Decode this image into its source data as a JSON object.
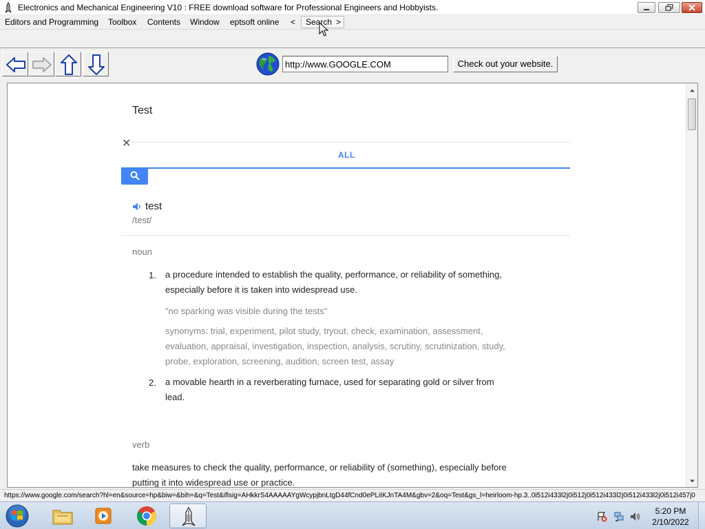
{
  "window": {
    "title": "Electronics and Mechanical Engineering V10 : FREE download software for Professional Engineers and Hobbyists."
  },
  "menu": {
    "items": [
      "Editors and Programming",
      "Toolbox",
      "Contents",
      "Window",
      "eptsoft online",
      "<"
    ],
    "search_label": "Search",
    "search_arrow": ">"
  },
  "navbar": {
    "url_value": "http://www.GOOGLE.COM",
    "check_button": "Check out your website."
  },
  "page": {
    "query": "Test",
    "close_symbol": "✕",
    "tab_all": "ALL",
    "word": "test",
    "phonetic": "/test/",
    "noun_label": "noun",
    "definitions": [
      {
        "number": "1.",
        "line1": "a procedure intended to establish the quality, performance, or reliability of something,",
        "line2": "especially before it is taken into widespread use."
      },
      {
        "number": "2.",
        "line1": "a movable hearth in a reverberating furnace, used for separating gold or silver from",
        "line2": "lead."
      }
    ],
    "example": "\"no sparking was visible during the tests\"",
    "synonyms_lines": [
      "synonyms: trial, experiment, pilot study, tryout, check, examination, assessment,",
      "evaluation, appraisal, investigation, inspection, analysis, scrutiny, scrutinization, study,",
      "probe, exploration, screening, audition, screen test, assay"
    ],
    "verb_label": "verb",
    "verb_line1": "take measures to check the quality, performance, or reliability of (something), especially before",
    "verb_line2": "putting it into widespread use or practice."
  },
  "status": {
    "url": "https://www.google.com/search?hl=en&source=hp&biw=&bih=&q=Test&iflsig=AHkkrS4AAAAAYgWcypjbnLtgD44fCnd0ePLiIKJnTA4M&gbv=2&oq=Test&gs_l=heirloom-hp.3..0i512i433l2j0i512j0i512i433l2j0i512i433l2j0i512i457j0"
  },
  "taskbar": {
    "time": "5:20 PM",
    "date": "2/10/2022"
  },
  "icons": {
    "app": "rocket-icon",
    "globe": "globe-icon",
    "back": "arrow-left-icon",
    "forward": "arrow-right-icon",
    "up": "arrow-up-icon",
    "down": "arrow-down-icon"
  }
}
